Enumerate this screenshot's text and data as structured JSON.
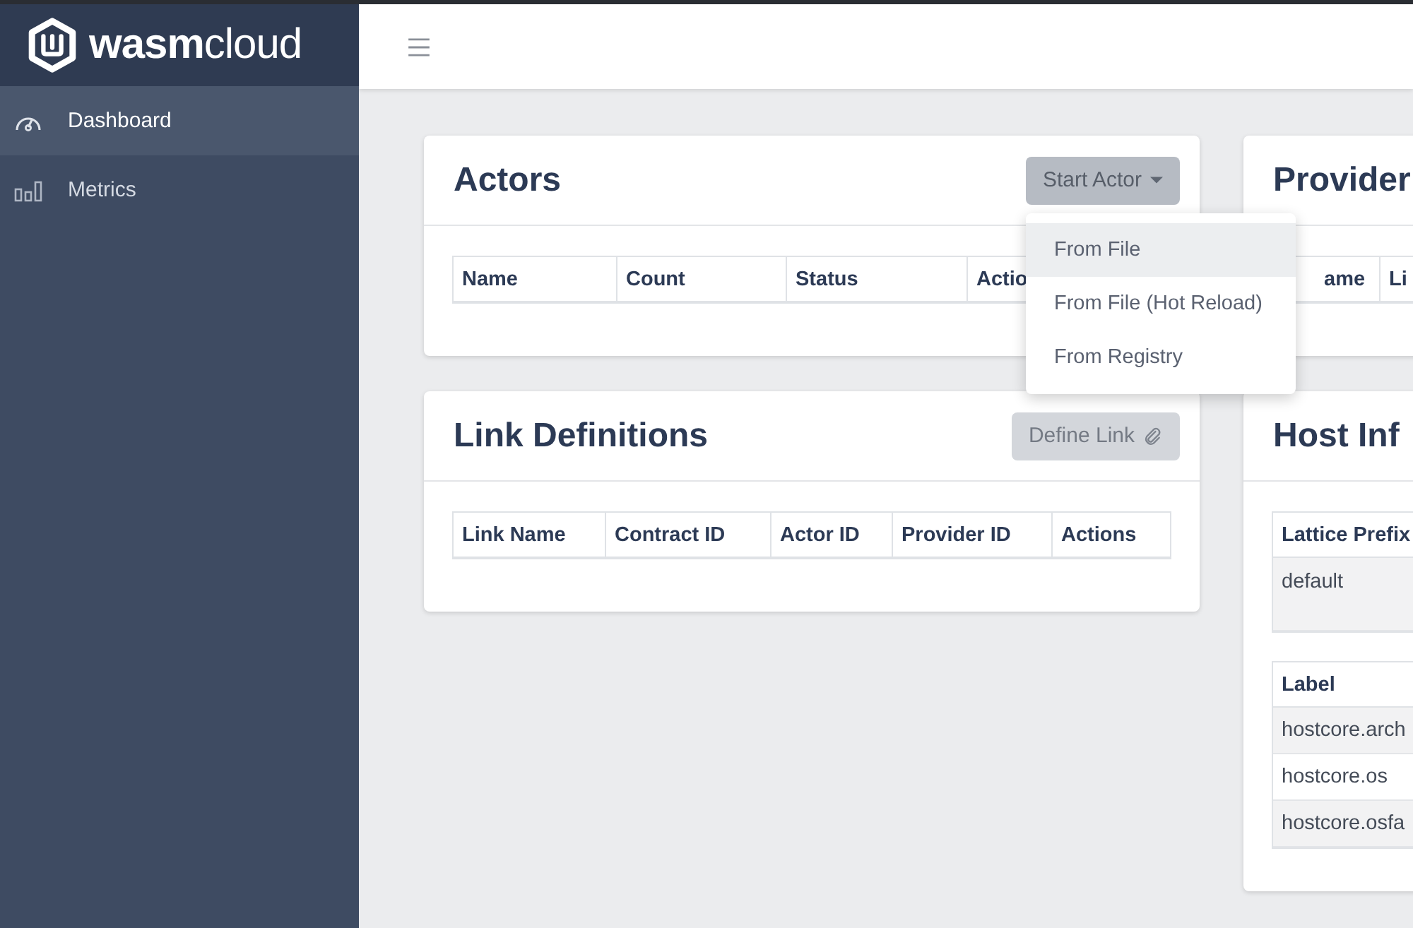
{
  "sidebar": {
    "brand": {
      "bold": "wasm",
      "light": "cloud"
    },
    "items": [
      {
        "label": "Dashboard",
        "kind": "gauge",
        "selected": true
      },
      {
        "label": "Metrics",
        "kind": "bars",
        "selected": false
      }
    ]
  },
  "actors": {
    "title": "Actors",
    "button": "Start Actor",
    "columns": [
      "Name",
      "Count",
      "Status",
      "Actio"
    ],
    "menu": [
      {
        "label": "From File",
        "selected": true
      },
      {
        "label": "From File (Hot Reload)",
        "selected": false
      },
      {
        "label": "From Registry",
        "selected": false
      }
    ]
  },
  "link_definitions": {
    "title": "Link Definitions",
    "button": "Define Link",
    "columns": [
      "Link Name",
      "Contract ID",
      "Actor ID",
      "Provider ID",
      "Actions"
    ]
  },
  "providers": {
    "title": "Provider",
    "columns": [
      "ame",
      "Li"
    ]
  },
  "host_info": {
    "title": "Host Inf",
    "prefix_header": "Lattice Prefix",
    "prefix": "default",
    "label_header": "Label",
    "labels": [
      "hostcore.arch",
      "hostcore.os",
      "hostcore.osfa"
    ]
  }
}
